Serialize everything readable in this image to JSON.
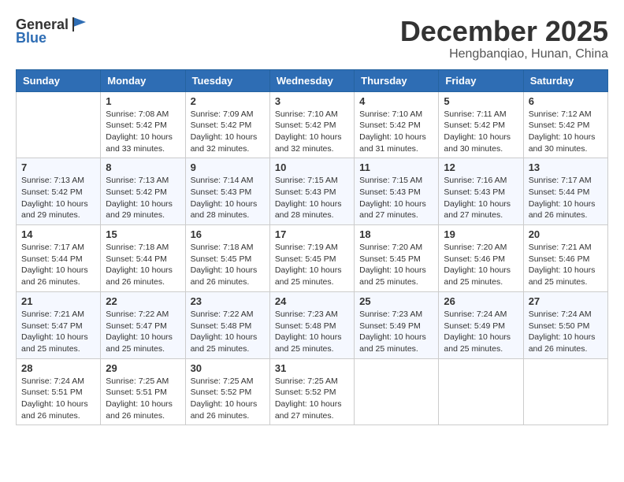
{
  "header": {
    "logo_general": "General",
    "logo_blue": "Blue",
    "month": "December 2025",
    "location": "Hengbanqiao, Hunan, China"
  },
  "days_of_week": [
    "Sunday",
    "Monday",
    "Tuesday",
    "Wednesday",
    "Thursday",
    "Friday",
    "Saturday"
  ],
  "weeks": [
    [
      {
        "day": "",
        "sunrise": "",
        "sunset": "",
        "daylight": ""
      },
      {
        "day": "1",
        "sunrise": "Sunrise: 7:08 AM",
        "sunset": "Sunset: 5:42 PM",
        "daylight": "Daylight: 10 hours and 33 minutes."
      },
      {
        "day": "2",
        "sunrise": "Sunrise: 7:09 AM",
        "sunset": "Sunset: 5:42 PM",
        "daylight": "Daylight: 10 hours and 32 minutes."
      },
      {
        "day": "3",
        "sunrise": "Sunrise: 7:10 AM",
        "sunset": "Sunset: 5:42 PM",
        "daylight": "Daylight: 10 hours and 32 minutes."
      },
      {
        "day": "4",
        "sunrise": "Sunrise: 7:10 AM",
        "sunset": "Sunset: 5:42 PM",
        "daylight": "Daylight: 10 hours and 31 minutes."
      },
      {
        "day": "5",
        "sunrise": "Sunrise: 7:11 AM",
        "sunset": "Sunset: 5:42 PM",
        "daylight": "Daylight: 10 hours and 30 minutes."
      },
      {
        "day": "6",
        "sunrise": "Sunrise: 7:12 AM",
        "sunset": "Sunset: 5:42 PM",
        "daylight": "Daylight: 10 hours and 30 minutes."
      }
    ],
    [
      {
        "day": "7",
        "sunrise": "Sunrise: 7:13 AM",
        "sunset": "Sunset: 5:42 PM",
        "daylight": "Daylight: 10 hours and 29 minutes."
      },
      {
        "day": "8",
        "sunrise": "Sunrise: 7:13 AM",
        "sunset": "Sunset: 5:42 PM",
        "daylight": "Daylight: 10 hours and 29 minutes."
      },
      {
        "day": "9",
        "sunrise": "Sunrise: 7:14 AM",
        "sunset": "Sunset: 5:43 PM",
        "daylight": "Daylight: 10 hours and 28 minutes."
      },
      {
        "day": "10",
        "sunrise": "Sunrise: 7:15 AM",
        "sunset": "Sunset: 5:43 PM",
        "daylight": "Daylight: 10 hours and 28 minutes."
      },
      {
        "day": "11",
        "sunrise": "Sunrise: 7:15 AM",
        "sunset": "Sunset: 5:43 PM",
        "daylight": "Daylight: 10 hours and 27 minutes."
      },
      {
        "day": "12",
        "sunrise": "Sunrise: 7:16 AM",
        "sunset": "Sunset: 5:43 PM",
        "daylight": "Daylight: 10 hours and 27 minutes."
      },
      {
        "day": "13",
        "sunrise": "Sunrise: 7:17 AM",
        "sunset": "Sunset: 5:44 PM",
        "daylight": "Daylight: 10 hours and 26 minutes."
      }
    ],
    [
      {
        "day": "14",
        "sunrise": "Sunrise: 7:17 AM",
        "sunset": "Sunset: 5:44 PM",
        "daylight": "Daylight: 10 hours and 26 minutes."
      },
      {
        "day": "15",
        "sunrise": "Sunrise: 7:18 AM",
        "sunset": "Sunset: 5:44 PM",
        "daylight": "Daylight: 10 hours and 26 minutes."
      },
      {
        "day": "16",
        "sunrise": "Sunrise: 7:18 AM",
        "sunset": "Sunset: 5:45 PM",
        "daylight": "Daylight: 10 hours and 26 minutes."
      },
      {
        "day": "17",
        "sunrise": "Sunrise: 7:19 AM",
        "sunset": "Sunset: 5:45 PM",
        "daylight": "Daylight: 10 hours and 25 minutes."
      },
      {
        "day": "18",
        "sunrise": "Sunrise: 7:20 AM",
        "sunset": "Sunset: 5:45 PM",
        "daylight": "Daylight: 10 hours and 25 minutes."
      },
      {
        "day": "19",
        "sunrise": "Sunrise: 7:20 AM",
        "sunset": "Sunset: 5:46 PM",
        "daylight": "Daylight: 10 hours and 25 minutes."
      },
      {
        "day": "20",
        "sunrise": "Sunrise: 7:21 AM",
        "sunset": "Sunset: 5:46 PM",
        "daylight": "Daylight: 10 hours and 25 minutes."
      }
    ],
    [
      {
        "day": "21",
        "sunrise": "Sunrise: 7:21 AM",
        "sunset": "Sunset: 5:47 PM",
        "daylight": "Daylight: 10 hours and 25 minutes."
      },
      {
        "day": "22",
        "sunrise": "Sunrise: 7:22 AM",
        "sunset": "Sunset: 5:47 PM",
        "daylight": "Daylight: 10 hours and 25 minutes."
      },
      {
        "day": "23",
        "sunrise": "Sunrise: 7:22 AM",
        "sunset": "Sunset: 5:48 PM",
        "daylight": "Daylight: 10 hours and 25 minutes."
      },
      {
        "day": "24",
        "sunrise": "Sunrise: 7:23 AM",
        "sunset": "Sunset: 5:48 PM",
        "daylight": "Daylight: 10 hours and 25 minutes."
      },
      {
        "day": "25",
        "sunrise": "Sunrise: 7:23 AM",
        "sunset": "Sunset: 5:49 PM",
        "daylight": "Daylight: 10 hours and 25 minutes."
      },
      {
        "day": "26",
        "sunrise": "Sunrise: 7:24 AM",
        "sunset": "Sunset: 5:49 PM",
        "daylight": "Daylight: 10 hours and 25 minutes."
      },
      {
        "day": "27",
        "sunrise": "Sunrise: 7:24 AM",
        "sunset": "Sunset: 5:50 PM",
        "daylight": "Daylight: 10 hours and 26 minutes."
      }
    ],
    [
      {
        "day": "28",
        "sunrise": "Sunrise: 7:24 AM",
        "sunset": "Sunset: 5:51 PM",
        "daylight": "Daylight: 10 hours and 26 minutes."
      },
      {
        "day": "29",
        "sunrise": "Sunrise: 7:25 AM",
        "sunset": "Sunset: 5:51 PM",
        "daylight": "Daylight: 10 hours and 26 minutes."
      },
      {
        "day": "30",
        "sunrise": "Sunrise: 7:25 AM",
        "sunset": "Sunset: 5:52 PM",
        "daylight": "Daylight: 10 hours and 26 minutes."
      },
      {
        "day": "31",
        "sunrise": "Sunrise: 7:25 AM",
        "sunset": "Sunset: 5:52 PM",
        "daylight": "Daylight: 10 hours and 27 minutes."
      },
      {
        "day": "",
        "sunrise": "",
        "sunset": "",
        "daylight": ""
      },
      {
        "day": "",
        "sunrise": "",
        "sunset": "",
        "daylight": ""
      },
      {
        "day": "",
        "sunrise": "",
        "sunset": "",
        "daylight": ""
      }
    ]
  ]
}
